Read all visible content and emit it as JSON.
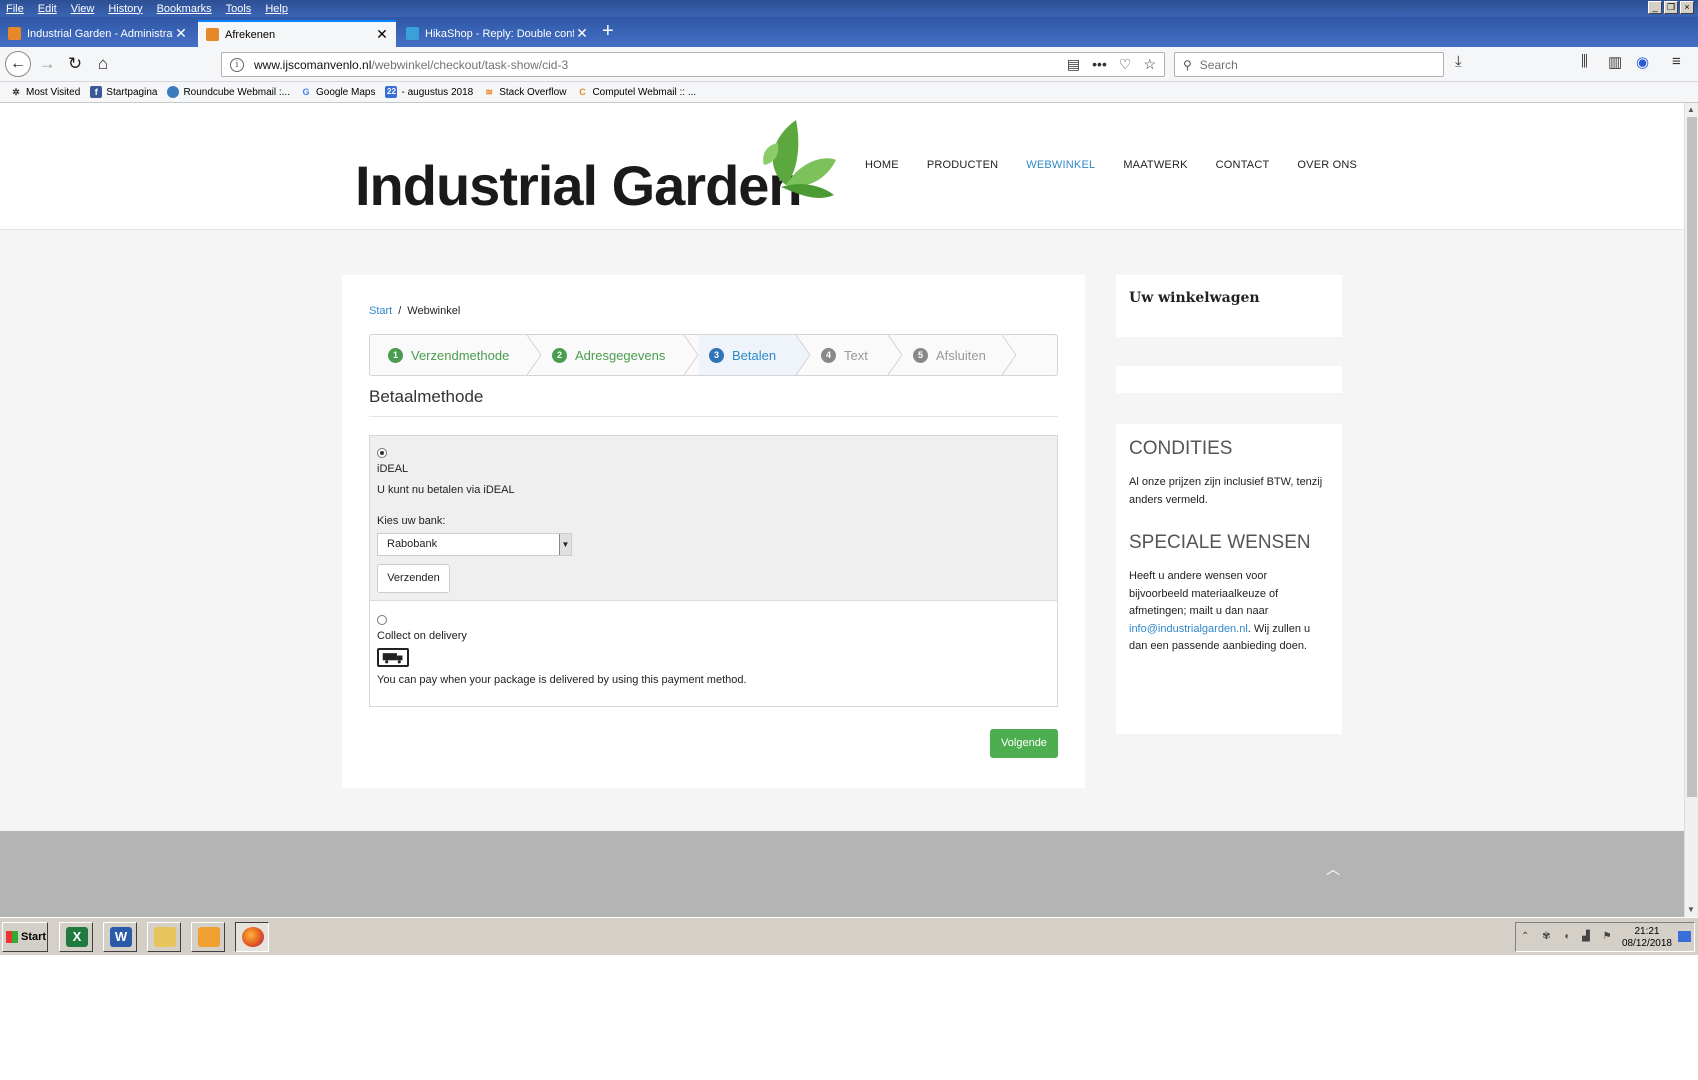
{
  "menubar": {
    "items": [
      "File",
      "Edit",
      "View",
      "History",
      "Bookmarks",
      "Tools",
      "Help"
    ]
  },
  "tabs": [
    {
      "label": "Industrial Garden - Administration",
      "active": false
    },
    {
      "label": "Afrekenen",
      "active": true
    },
    {
      "label": "HikaShop - Reply: Double confirma",
      "active": false
    }
  ],
  "address": {
    "url_host": "www.ijscomanvenlo.nl",
    "url_path": "/webwinkel/checkout/task-show/cid-3",
    "search_placeholder": "Search"
  },
  "bookmarks": [
    "Most Visited",
    "Startpagina",
    "Roundcube Webmail :...",
    "Google Maps",
    "- augustus 2018",
    "Stack Overflow",
    "Computel Webmail :: ..."
  ],
  "bookmark_icons": {
    "calendar_num": "22"
  },
  "site": {
    "logo": "Industrial Garden",
    "nav": [
      "HOME",
      "PRODUCTEN",
      "WEBWINKEL",
      "MAATWERK",
      "CONTACT",
      "OVER ONS"
    ],
    "nav_active": "WEBWINKEL"
  },
  "breadcrumb": {
    "start": "Start",
    "sep": "/",
    "current": "Webwinkel"
  },
  "steps": [
    {
      "num": "1",
      "label": "Verzendmethode",
      "state": "done"
    },
    {
      "num": "2",
      "label": "Adresgegevens",
      "state": "done"
    },
    {
      "num": "3",
      "label": "Betalen",
      "state": "current"
    },
    {
      "num": "4",
      "label": "Text",
      "state": "todo"
    },
    {
      "num": "5",
      "label": "Afsluiten",
      "state": "todo"
    }
  ],
  "payment": {
    "title": "Betaalmethode",
    "ideal": {
      "name": "iDEAL",
      "description": "U kunt nu betalen via iDEAL",
      "bank_label": "Kies uw bank:",
      "bank_selected": "Rabobank",
      "submit": "Verzenden",
      "selected": true
    },
    "cod": {
      "name": "Collect on delivery",
      "description": "You can pay when your package is delivered by using this payment method.",
      "selected": false
    },
    "next": "Volgende"
  },
  "sidebar": {
    "cart_title": "Uw winkelwagen",
    "conditions_title": "CONDITIES",
    "conditions_text": "Al onze prijzen zijn inclusief BTW, tenzij anders vermeld.",
    "wishes_title": "SPECIALE WENSEN",
    "wishes_text_1": "Heeft u andere wensen voor bijvoorbeeld materiaalkeuze of afmetingen; mailt u dan naar",
    "wishes_email": "info@industrialgarden.nl",
    "wishes_text_2": ". Wij zullen u dan een passende aanbieding doen."
  },
  "taskbar": {
    "start": "Start",
    "time": "21:21",
    "date": "08/12/2018"
  },
  "colors": {
    "accent_blue": "#2f89c8",
    "step_green": "#4a9c4e",
    "button_green": "#4cae4f",
    "footer_gray": "#b4b4b4",
    "titlebar_blue": "#2f57a6"
  }
}
